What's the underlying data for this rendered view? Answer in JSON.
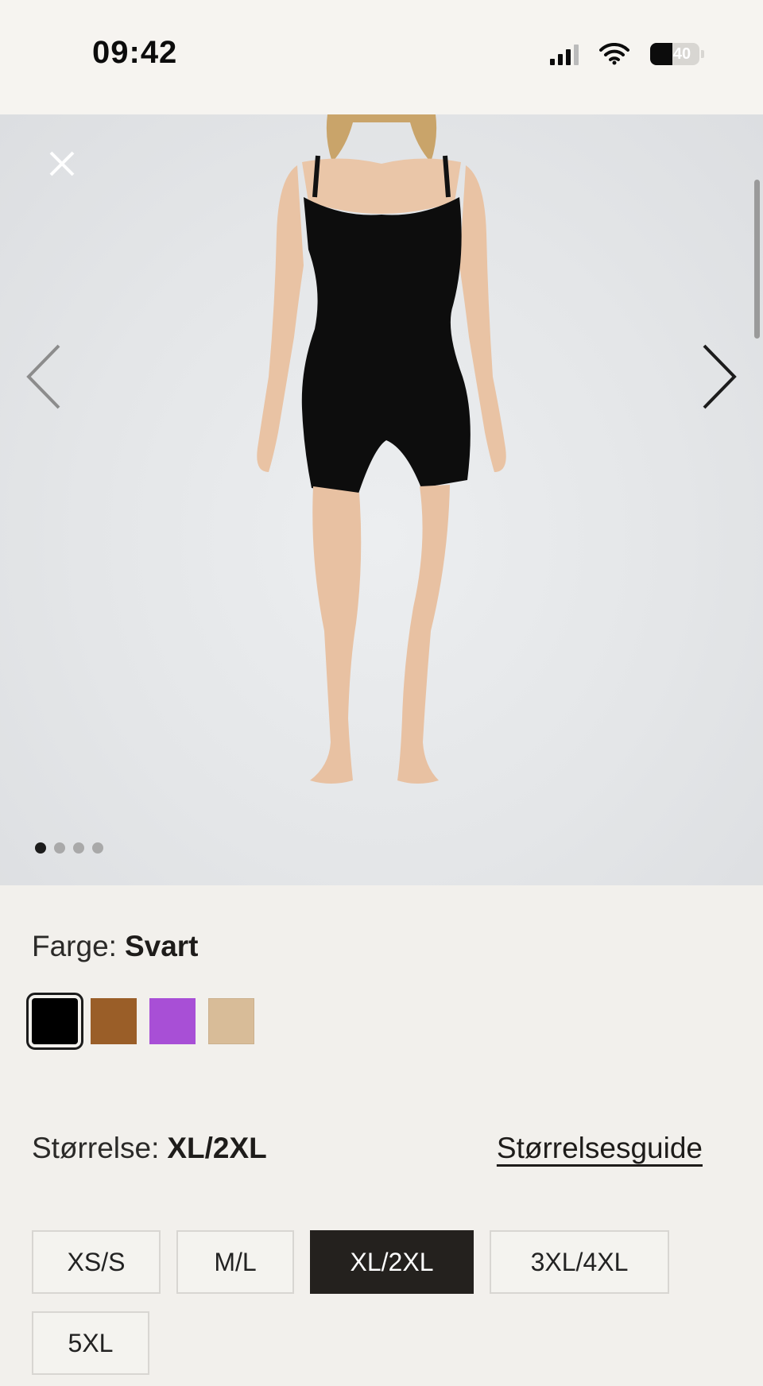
{
  "status_bar": {
    "time": "09:42",
    "battery": "40"
  },
  "gallery": {
    "image_icon": "product-photo-black-bodysuit",
    "dot_count": 4,
    "active_dot": 0
  },
  "color": {
    "label": "Farge:",
    "selected_value": "Svart",
    "swatches": [
      {
        "name": "black",
        "hex": "#000000",
        "selected": true
      },
      {
        "name": "brown",
        "hex": "#9a5e28",
        "selected": false
      },
      {
        "name": "purple",
        "hex": "#a84fd6",
        "selected": false
      },
      {
        "name": "beige",
        "hex": "#d8bc98",
        "selected": false
      }
    ]
  },
  "size": {
    "label": "Størrelse:",
    "selected_value": "XL/2XL",
    "guide_link": "Størrelsesguide",
    "options": [
      "XS/S",
      "M/L",
      "XL/2XL",
      "3XL/4XL",
      "5XL"
    ]
  },
  "colors": {
    "selected_size_bg": "#24211e",
    "page_bg": "#f2f0ec"
  }
}
